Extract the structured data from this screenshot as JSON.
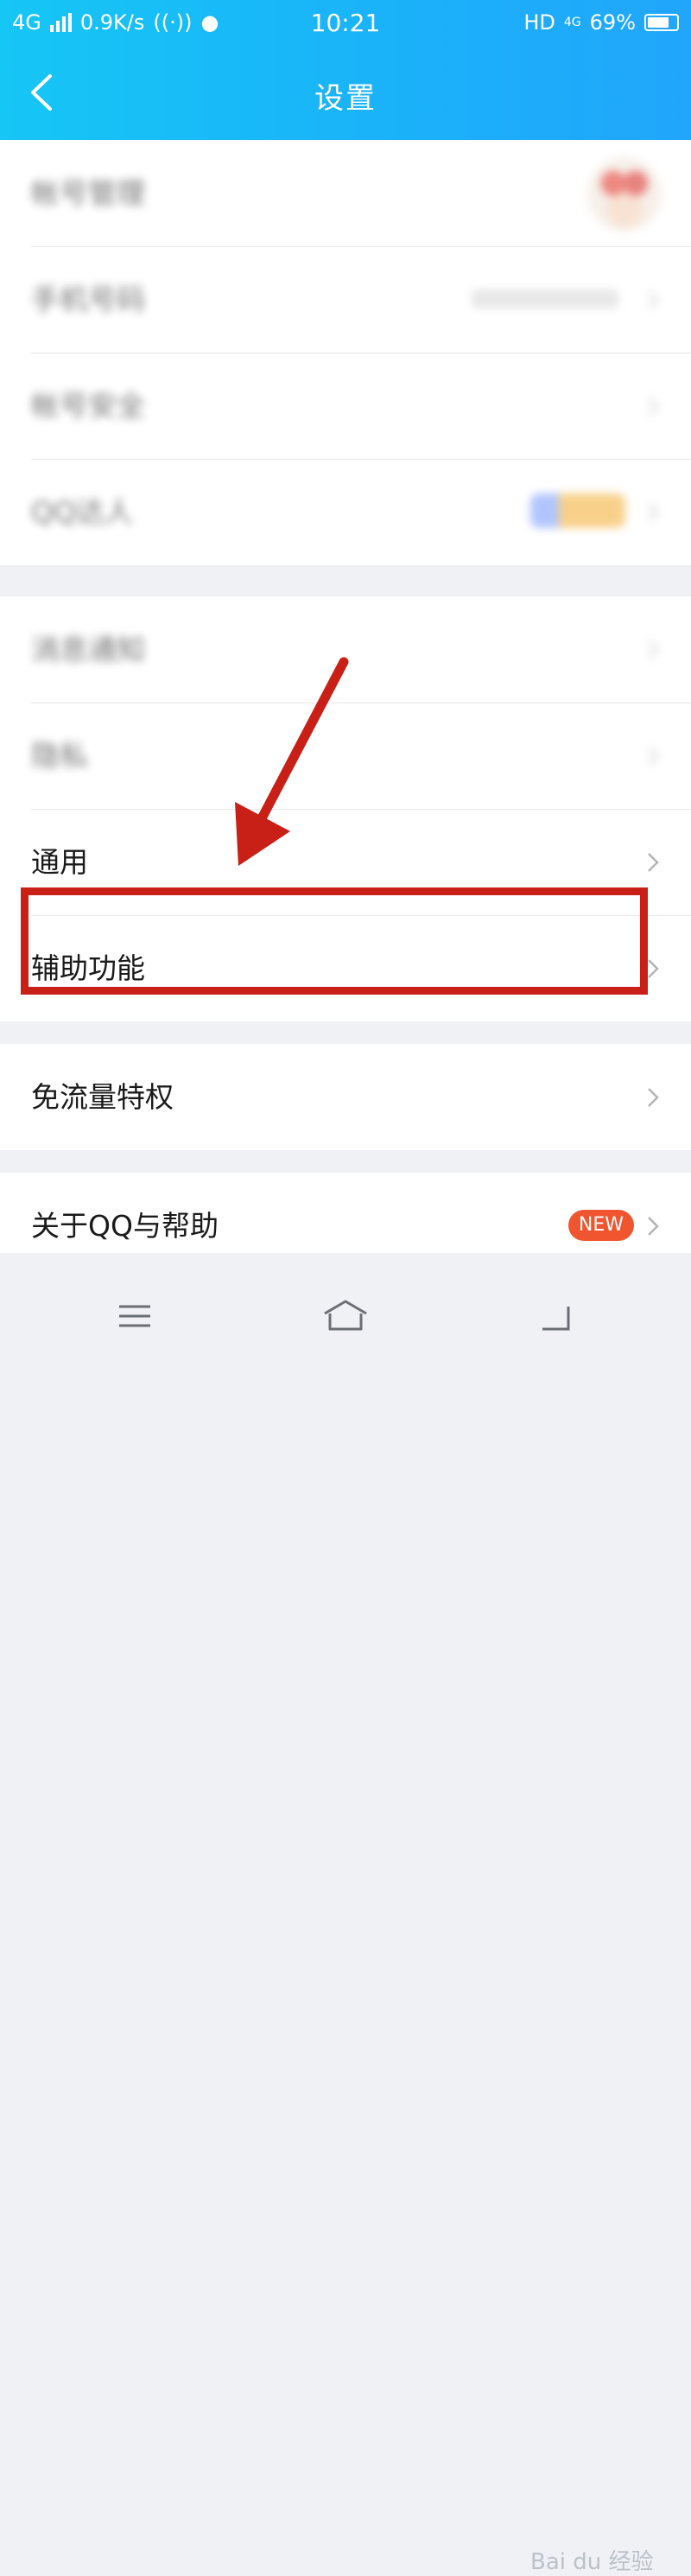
{
  "status_bar": {
    "network": "4G",
    "speed": "0.9K/s",
    "time": "10:21",
    "hd": "HD",
    "sub_network": "4G",
    "battery": "69%"
  },
  "header": {
    "title": "设置"
  },
  "groups": [
    {
      "items": [
        {
          "label": "帐号管理"
        },
        {
          "label": "手机号码"
        },
        {
          "label": "帐号安全"
        },
        {
          "label": "QQ达人"
        }
      ]
    },
    {
      "items": [
        {
          "label": "消息通知"
        },
        {
          "label": "隐私"
        },
        {
          "label": "通用"
        },
        {
          "label": "辅助功能"
        }
      ]
    },
    {
      "items": [
        {
          "label": "免流量特权"
        }
      ]
    },
    {
      "items": [
        {
          "label": "关于QQ与帮助",
          "badge": "NEW"
        }
      ]
    }
  ],
  "colors": {
    "header_start": "#16c6f5",
    "header_end": "#21a6fb",
    "highlight": "#c81f16",
    "badge": "#f1552f"
  },
  "watermark": "Bai du 经验"
}
